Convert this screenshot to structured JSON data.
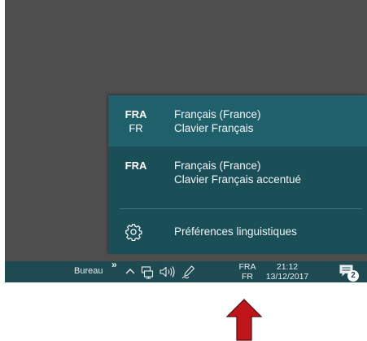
{
  "flyout": {
    "languages": [
      {
        "code": "FRA",
        "sub": "FR",
        "name": "Français (France)",
        "keyboard": "Clavier Français",
        "selected": true
      },
      {
        "code": "FRA",
        "sub": "",
        "name": "Français (France)",
        "keyboard": "Clavier Français accentué",
        "selected": false
      }
    ],
    "preferences": {
      "label": "Préférences linguistiques",
      "icon": "gear-icon"
    }
  },
  "taskbar": {
    "toolbar_label": "Bureau",
    "toolbar_chevron": "»",
    "tray": {
      "overflow_icon": "chevron-up-icon",
      "network_icon": "network-icon",
      "volume_icon": "speaker-volume-icon",
      "pen_icon": "pen-icon",
      "language": {
        "code": "FRA",
        "sub": "FR"
      },
      "clock": {
        "time": "21:12",
        "date": "13/12/2017"
      },
      "notifications": {
        "icon": "action-center-icon",
        "count": "2"
      }
    }
  },
  "annotation": {
    "arrow_color": "#c0151b",
    "arrow_icon": "red-up-arrow"
  },
  "colors": {
    "taskbar": "#1e4a52",
    "flyout": "#1b4f58",
    "flyout_selected": "#20606a",
    "desktop": "#4e4e4e"
  }
}
